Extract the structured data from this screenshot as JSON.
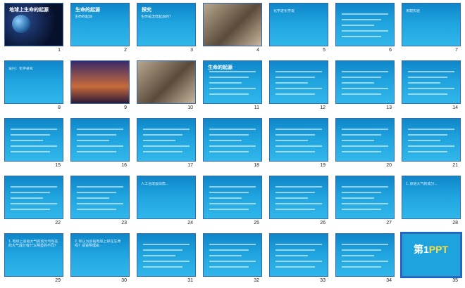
{
  "slides": [
    {
      "n": "1",
      "kind": "space",
      "title": "地球上生命的起源",
      "text": ""
    },
    {
      "n": "2",
      "kind": "blue",
      "title": "生命的起源",
      "text": "生命的起源"
    },
    {
      "n": "3",
      "kind": "blue",
      "title": "探究",
      "text": "生命是怎样起源的？"
    },
    {
      "n": "4",
      "kind": "photo",
      "title": "",
      "text": ""
    },
    {
      "n": "5",
      "kind": "blue",
      "title": "",
      "text": "化学进化学说"
    },
    {
      "n": "6",
      "kind": "blue",
      "title": "",
      "text": ""
    },
    {
      "n": "7",
      "kind": "blue",
      "title": "",
      "text": "米勒实验"
    },
    {
      "n": "8",
      "kind": "blue",
      "title": "",
      "text": "设问：化学进化"
    },
    {
      "n": "9",
      "kind": "dark",
      "title": "",
      "text": ""
    },
    {
      "n": "10",
      "kind": "photo",
      "title": "",
      "text": ""
    },
    {
      "n": "11",
      "kind": "blue",
      "title": "生命的起源",
      "text": ""
    },
    {
      "n": "12",
      "kind": "blue",
      "title": "",
      "text": ""
    },
    {
      "n": "13",
      "kind": "blue",
      "title": "",
      "text": ""
    },
    {
      "n": "14",
      "kind": "blue",
      "title": "",
      "text": ""
    },
    {
      "n": "15",
      "kind": "blue",
      "title": "",
      "text": ""
    },
    {
      "n": "16",
      "kind": "blue",
      "title": "",
      "text": ""
    },
    {
      "n": "17",
      "kind": "blue",
      "title": "",
      "text": ""
    },
    {
      "n": "18",
      "kind": "blue",
      "title": "",
      "text": ""
    },
    {
      "n": "19",
      "kind": "blue",
      "title": "",
      "text": ""
    },
    {
      "n": "20",
      "kind": "blue",
      "title": "",
      "text": ""
    },
    {
      "n": "21",
      "kind": "blue",
      "title": "",
      "text": ""
    },
    {
      "n": "22",
      "kind": "blue",
      "title": "",
      "text": ""
    },
    {
      "n": "23",
      "kind": "blue",
      "title": "",
      "text": ""
    },
    {
      "n": "24",
      "kind": "blue",
      "title": "",
      "text": "人工合成蛋白质..."
    },
    {
      "n": "25",
      "kind": "blue",
      "title": "",
      "text": ""
    },
    {
      "n": "26",
      "kind": "blue",
      "title": "",
      "text": ""
    },
    {
      "n": "27",
      "kind": "blue",
      "title": "",
      "text": ""
    },
    {
      "n": "28",
      "kind": "blue",
      "title": "",
      "text": "1. 原始大气的成分..."
    },
    {
      "n": "29",
      "kind": "blue",
      "title": "",
      "text": "1. 地球上原始大气的成分与现在的大气成分有什么明显的不同？"
    },
    {
      "n": "30",
      "kind": "blue",
      "title": "",
      "text": "2. 你认为原始地球上存在生命吗？请说明理由"
    },
    {
      "n": "31",
      "kind": "blue",
      "title": "",
      "text": ""
    },
    {
      "n": "32",
      "kind": "blue",
      "title": "",
      "text": ""
    },
    {
      "n": "33",
      "kind": "blue",
      "title": "",
      "text": ""
    },
    {
      "n": "34",
      "kind": "blue",
      "title": "",
      "text": ""
    },
    {
      "n": "35",
      "kind": "ppt",
      "title": "第1PPT",
      "text": ""
    }
  ],
  "selected": "35"
}
